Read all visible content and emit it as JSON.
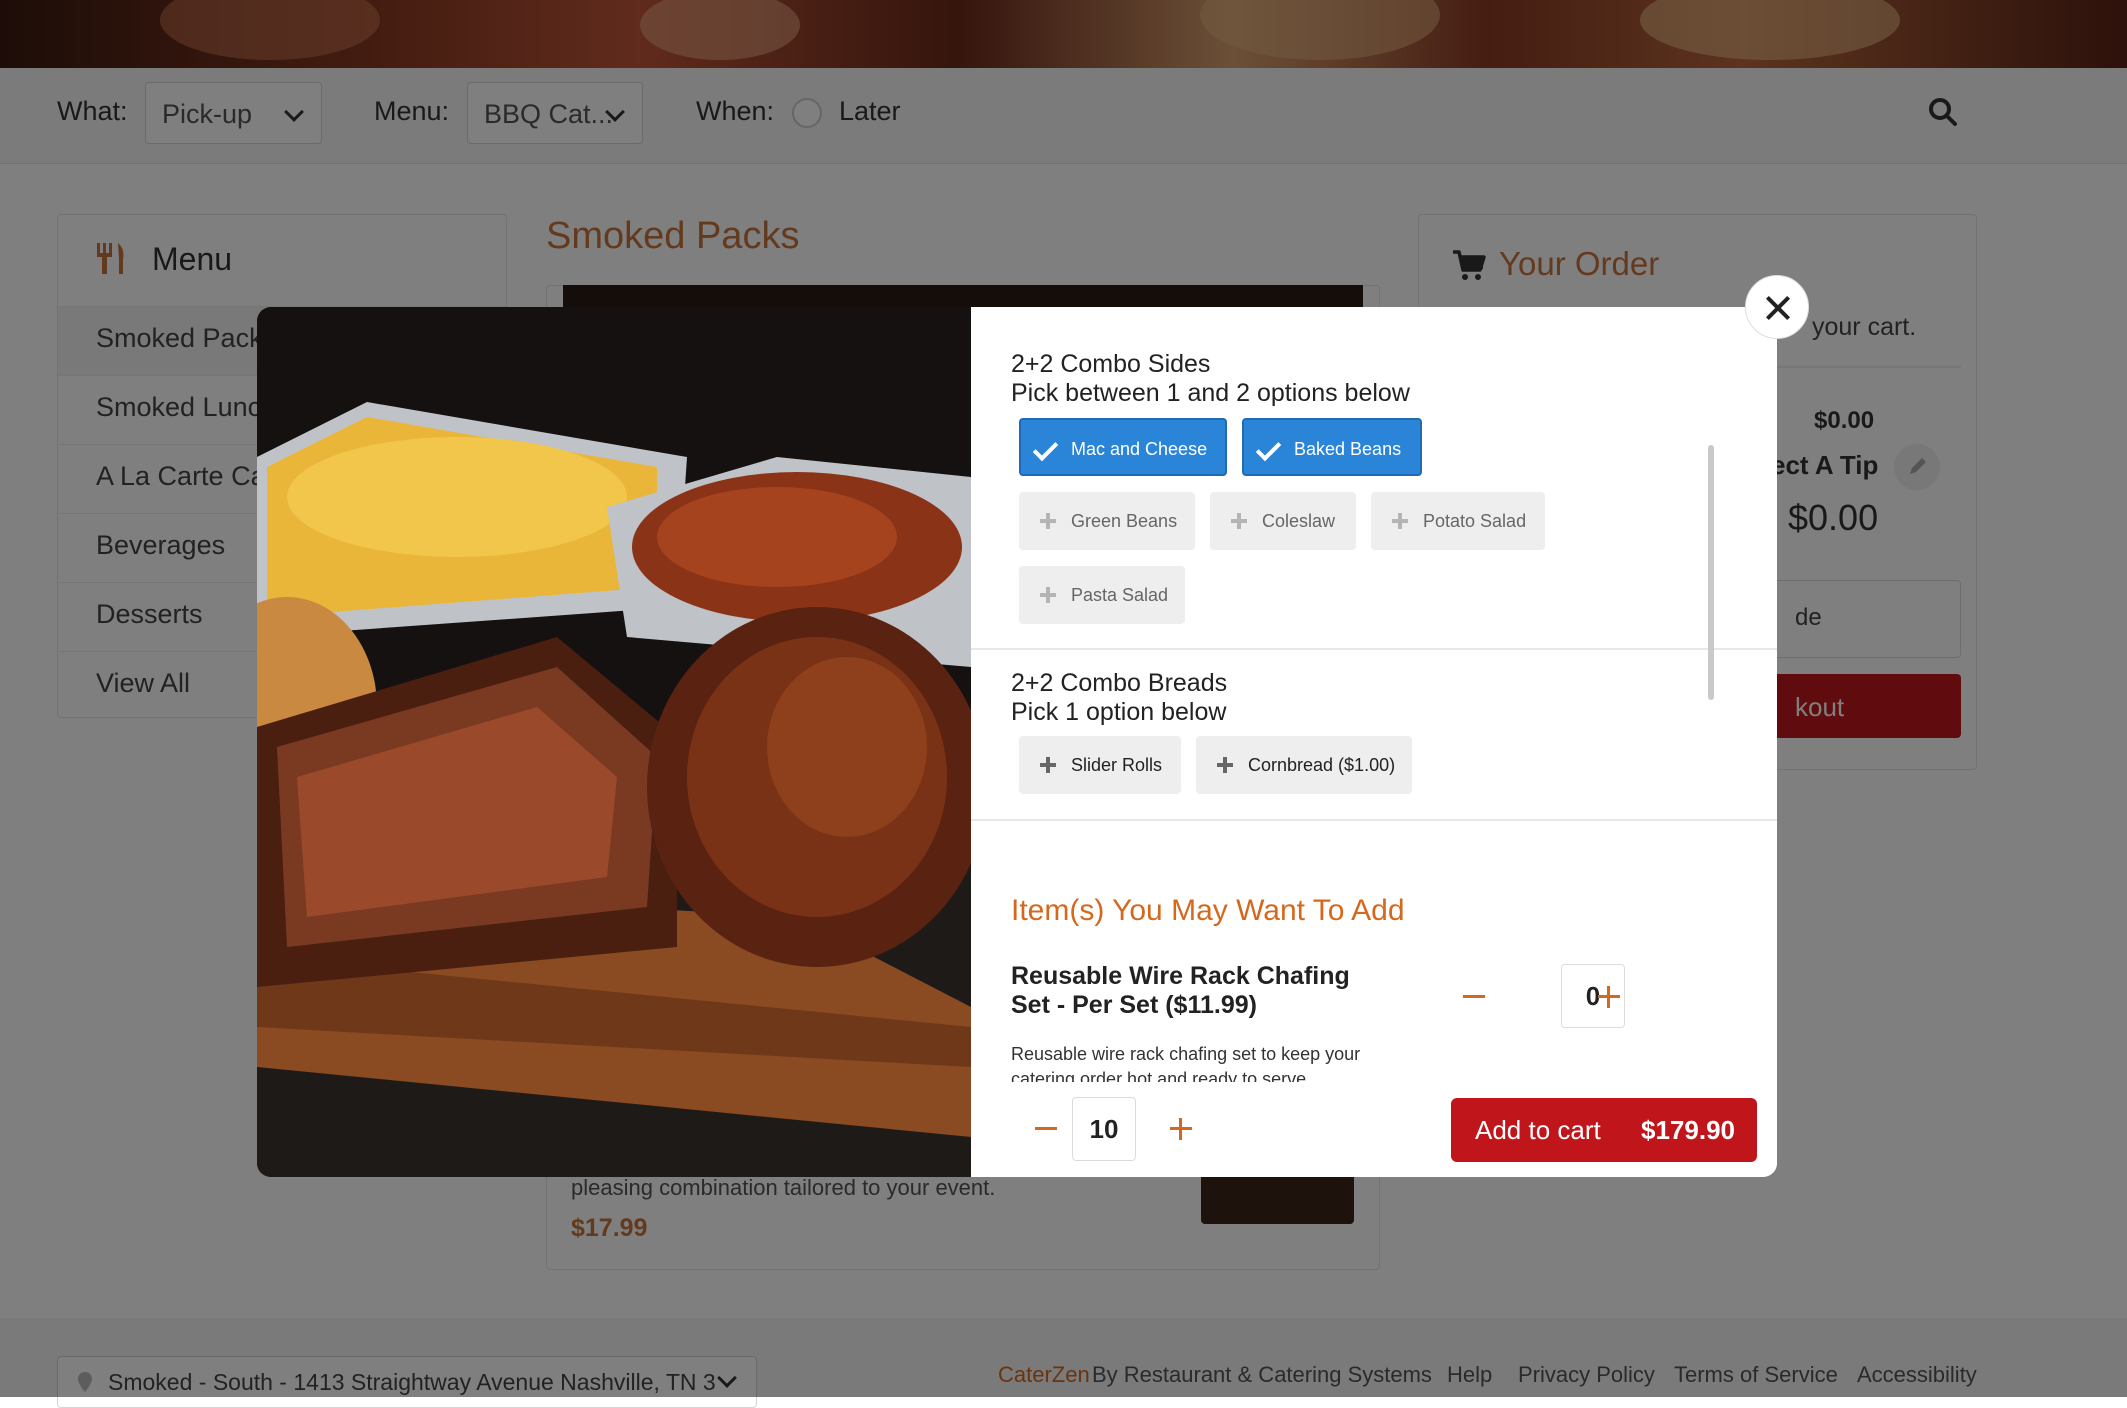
{
  "filters": {
    "what_label": "What:",
    "what_value": "Pick-up",
    "menu_label": "Menu:",
    "menu_value": "BBQ Cat...",
    "when_label": "When:",
    "when_option": "Later"
  },
  "sidebar": {
    "title": "Menu",
    "items": [
      {
        "label": "Smoked Packs"
      },
      {
        "label": "Smoked Lunches"
      },
      {
        "label": "A La Carte Catering"
      },
      {
        "label": "Beverages"
      },
      {
        "label": "Desserts"
      },
      {
        "label": "View All"
      }
    ]
  },
  "main": {
    "section_title": "Smoked Packs",
    "item_desc_tail": "pleasing combination tailored to your event.",
    "item_price": "$17.99"
  },
  "order": {
    "title": "Your Order",
    "cart_text": "your cart.",
    "subtotal": "$0.00",
    "tip_label": "ect A Tip",
    "total": "$0.00",
    "promo_placeholder": "de",
    "checkout_label": "kout"
  },
  "modal": {
    "sides": {
      "title": "2+2 Combo Sides",
      "subtitle": "Pick between 1 and 2 options below",
      "options": [
        {
          "label": "Mac and Cheese",
          "selected": true
        },
        {
          "label": "Baked Beans",
          "selected": true
        },
        {
          "label": "Green Beans",
          "selected": false
        },
        {
          "label": "Coleslaw",
          "selected": false
        },
        {
          "label": "Potato Salad",
          "selected": false
        },
        {
          "label": "Pasta Salad",
          "selected": false
        }
      ]
    },
    "breads": {
      "title": "2+2 Combo Breads",
      "subtitle": "Pick 1 option below",
      "options": [
        {
          "label": "Slider Rolls",
          "selected": false
        },
        {
          "label": "Cornbread ($1.00)",
          "selected": false
        }
      ]
    },
    "addons": {
      "title": "Item(s) You May Want To Add",
      "item_name": "Reusable Wire Rack Chafing Set - Per Set ($11.99)",
      "item_qty": "0",
      "item_desc": "Reusable wire rack chafing set to keep your catering order hot and ready to serve"
    },
    "quantity": "10",
    "add_to_cart_label": "Add to cart",
    "add_to_cart_price": "$179.90"
  },
  "footer": {
    "location": "Smoked - South - 1413 Straightway Avenue Nashville, TN 3",
    "brand": "CaterZen",
    "brand_suffix": "By Restaurant & Catering Systems",
    "links": [
      "Help",
      "Privacy Policy",
      "Terms of Service",
      "Accessibility"
    ]
  },
  "colors": {
    "accent_orange": "#d4691e",
    "selected_blue": "#2a85d9",
    "cart_red": "#c0161b"
  }
}
